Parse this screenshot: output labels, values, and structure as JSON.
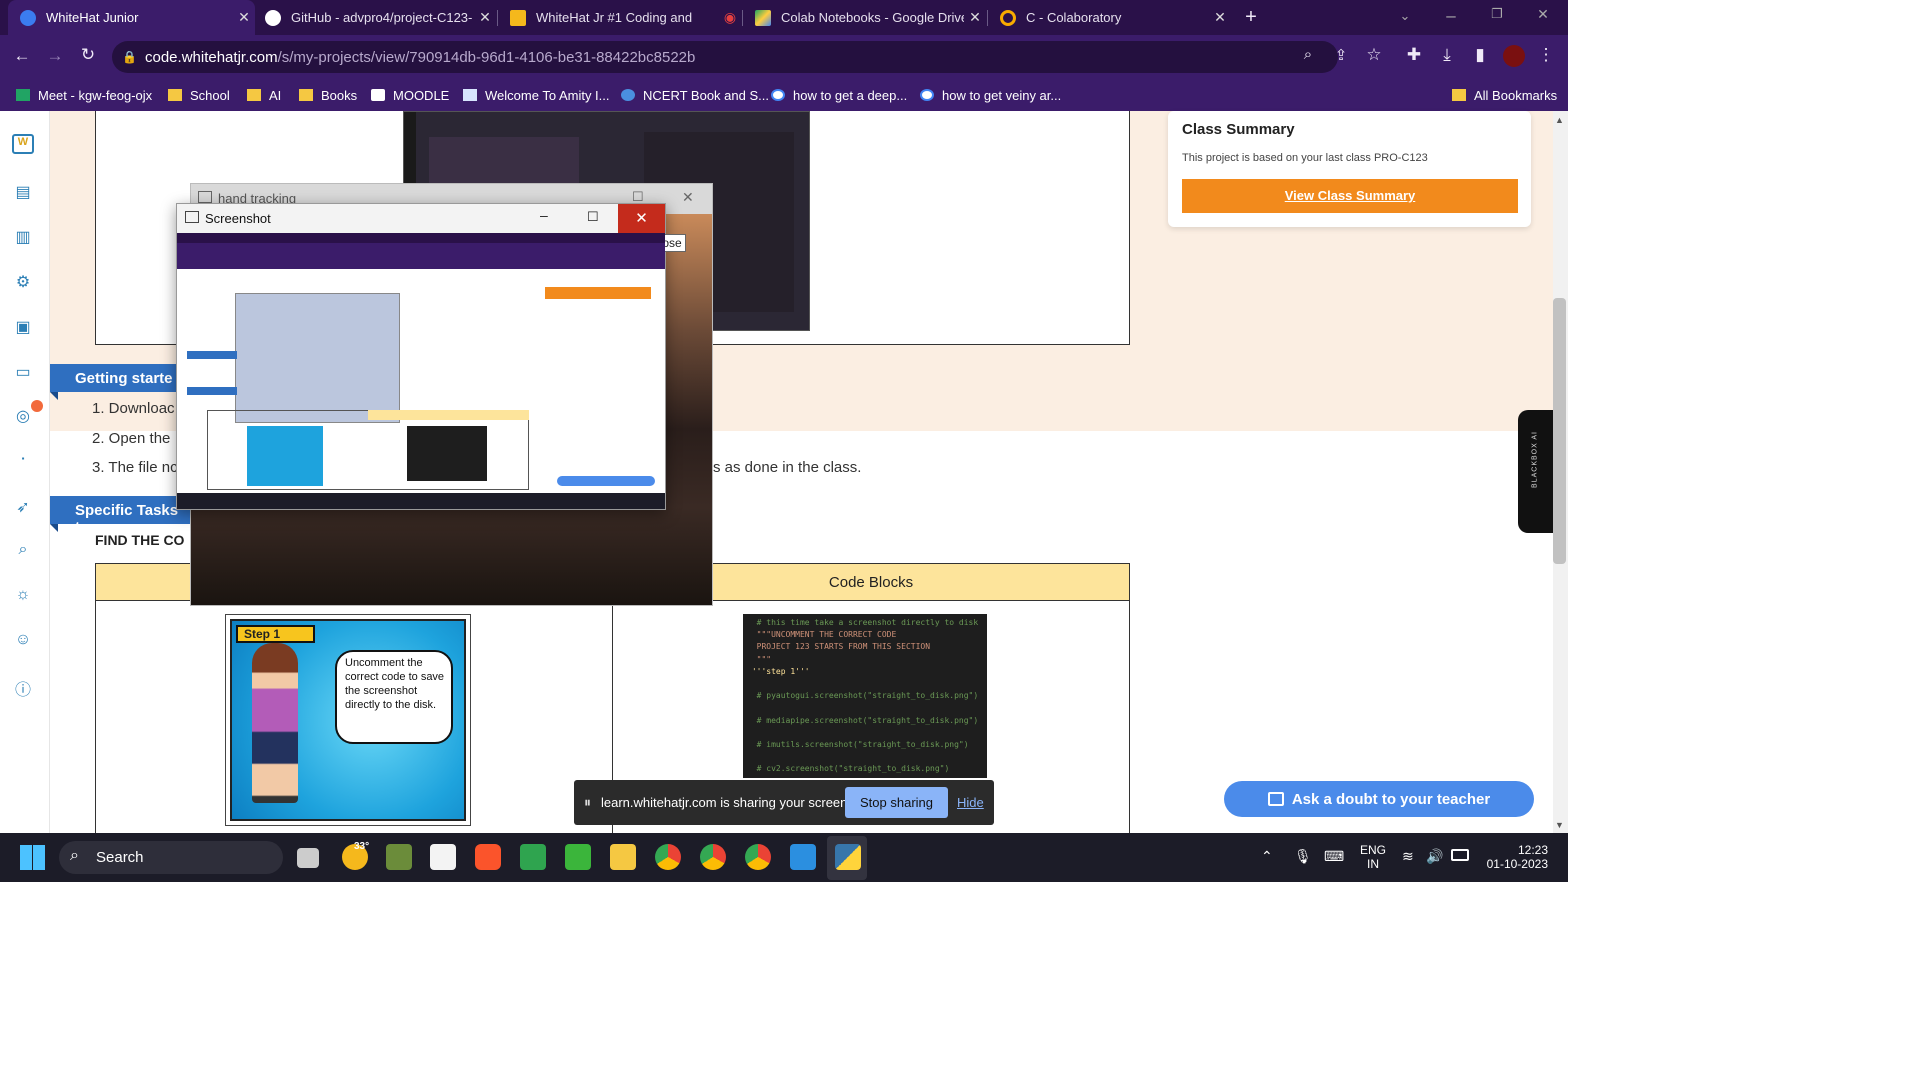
{
  "browser": {
    "tabs": [
      {
        "title": "WhiteHat Junior",
        "active": true
      },
      {
        "title": "GitHub - advpro4/project-C123-",
        "active": false
      },
      {
        "title": "WhiteHat Jr #1 Coding and",
        "active": false
      },
      {
        "title": "Colab Notebooks - Google Drive",
        "active": false
      },
      {
        "title": "C - Colaboratory",
        "active": false
      }
    ],
    "url_host": "code.whitehatjr.com",
    "url_path": "/s/my-projects/view/790914db-96d1-4106-be31-88422bc8522b",
    "bookmarks": [
      "Meet - kgw-feog-ojx",
      "School",
      "AI",
      "Books",
      "MOODLE",
      "Welcome To Amity I...",
      "NCERT Book and S...",
      "how to get a deep...",
      "how to get veiny ar..."
    ],
    "all_bookmarks": "All Bookmarks",
    "accent_color": "#3b1c6a"
  },
  "summary": {
    "title": "Class Summary",
    "text": "This project is based on your last class PRO-C123",
    "button": "View Class Summary",
    "button_color": "#f28a1c"
  },
  "getting_started": {
    "heading": "Getting starte",
    "items": [
      "1. Downloac",
      "2. Open the",
      "3. The file nc"
    ],
    "trailing_text": "s as done in the class."
  },
  "specific_tasks": {
    "heading": "Specific Tasks to",
    "find_label": "FIND THE CO"
  },
  "table": {
    "right_header": "Code Blocks",
    "step_badge": "Step 1",
    "speech": "Uncomment the correct code to save the screenshot directly to the disk.",
    "code_lines": [
      "  # this time take a screenshot directly to disk",
      "  \"\"\"UNCOMMENT THE CORRECT CODE",
      "  PROJECT 123 STARTS FROM THIS SECTION",
      "  \"\"\"",
      " '''step 1'''",
      "",
      "  # pyautogui.screenshot(\"straight_to_disk.png\")",
      "",
      "  # mediapipe.screenshot(\"straight_to_disk.png\")",
      "",
      "  # imutils.screenshot(\"straight_to_disk.png\")",
      "",
      "  # cv2.screenshot(\"straight_to_disk.png\")"
    ]
  },
  "windows": {
    "hand_tracking_title": "hand tracking",
    "screenshot_title": "Screenshot",
    "close_tooltip": "Close"
  },
  "sharing": {
    "message": "learn.whitehatjr.com is sharing your screen.",
    "stop": "Stop sharing",
    "hide": "Hide"
  },
  "ask_doubt": "Ask a doubt to your teacher",
  "blackbox_label": "BLACKBOX AI",
  "taskbar": {
    "search": "Search",
    "weather_temp": "33°",
    "lang_top": "ENG",
    "lang_bottom": "IN",
    "time": "12:23",
    "date": "01-10-2023"
  }
}
